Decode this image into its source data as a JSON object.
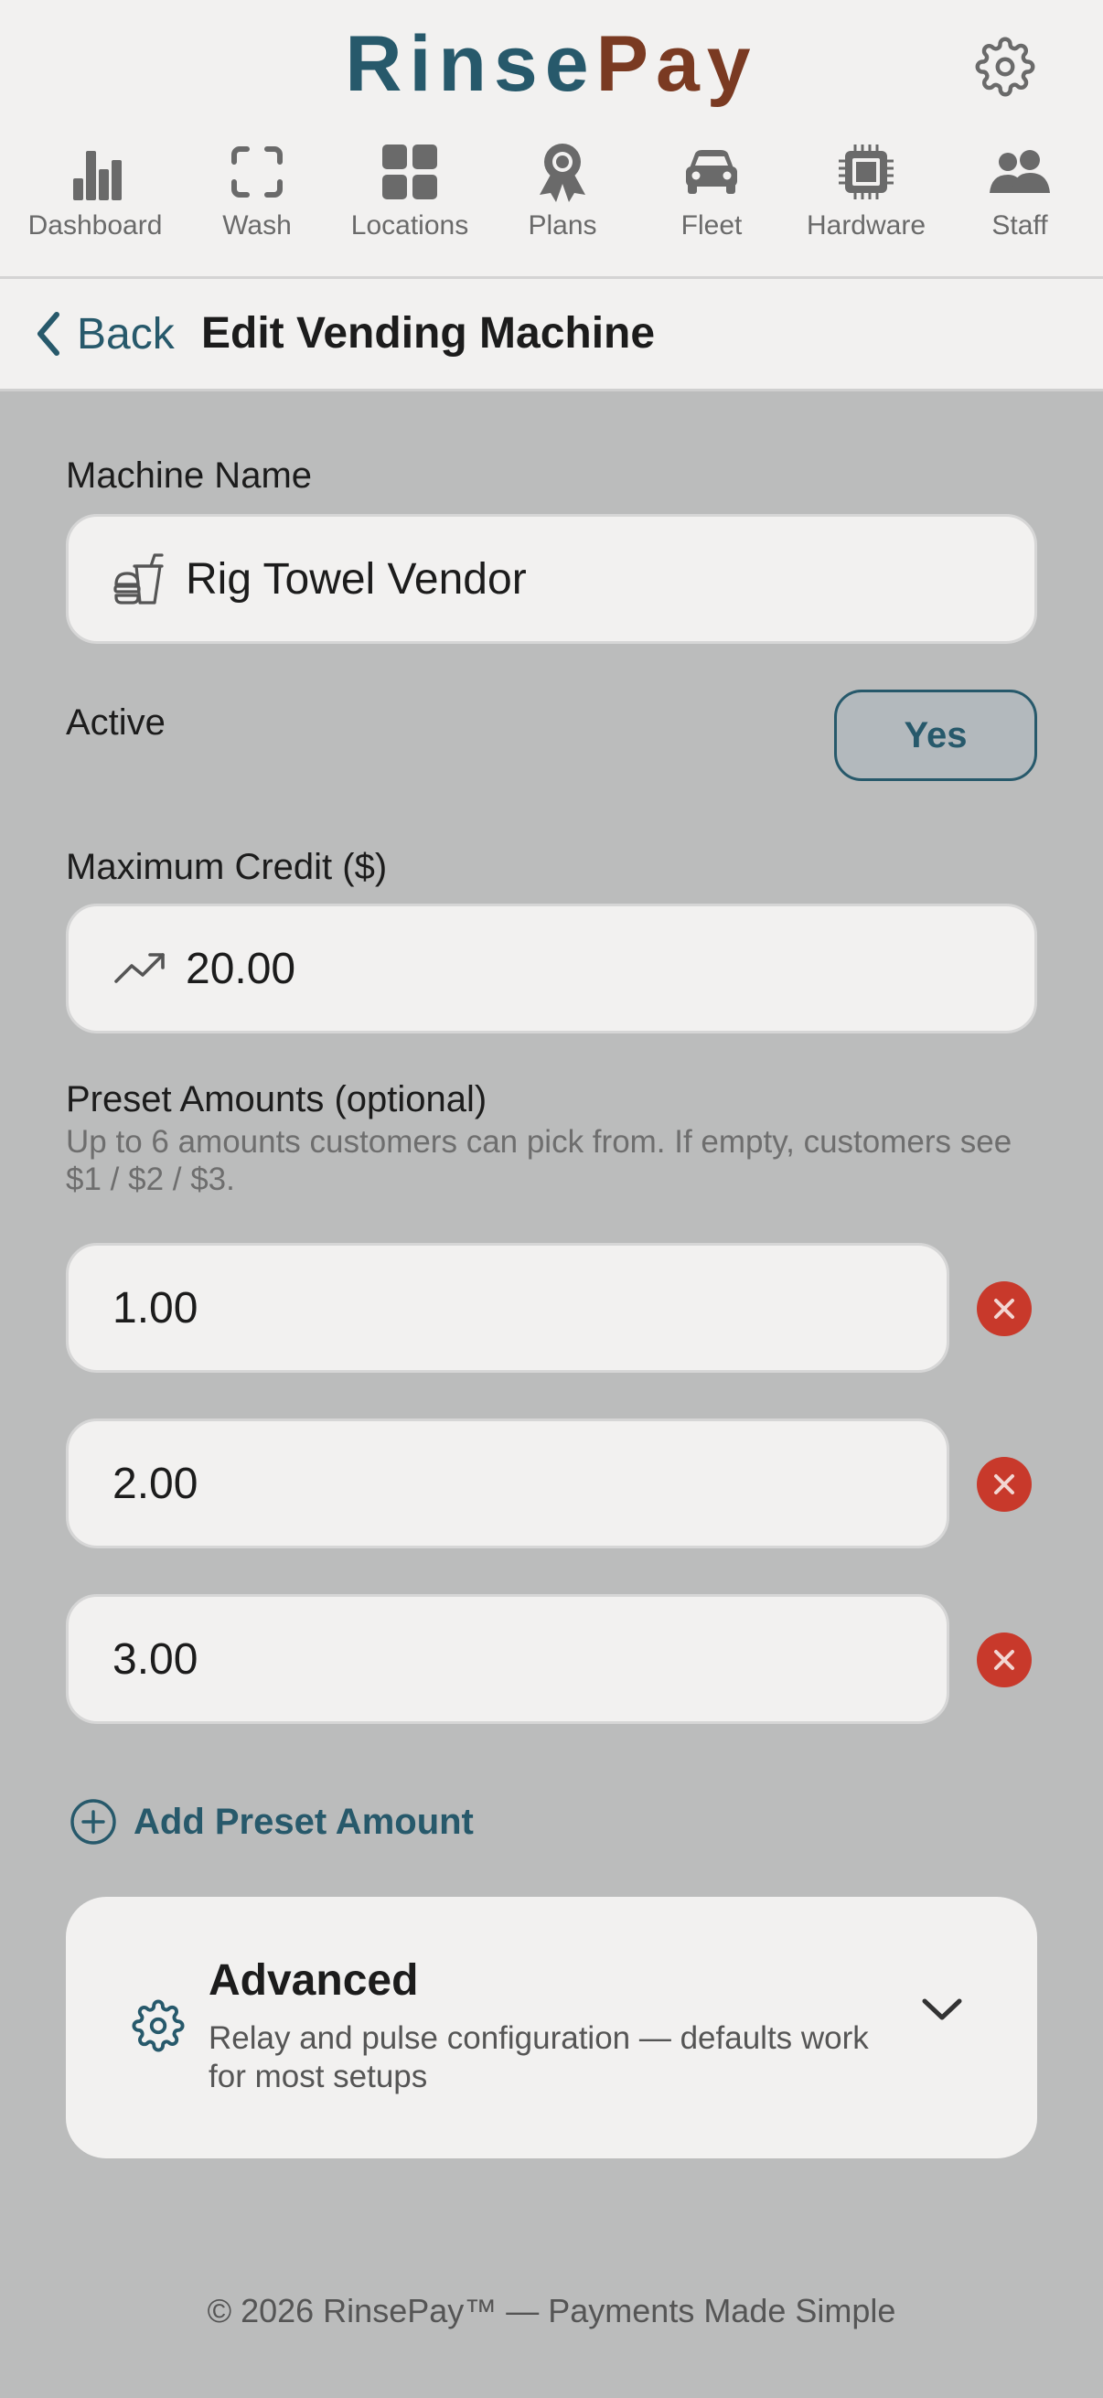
{
  "brand": {
    "part1": "Rinse",
    "part2": "Pay"
  },
  "header": {
    "settings_icon": "gear-icon"
  },
  "nav": [
    {
      "label": "Dashboard",
      "icon": "bar-chart-icon"
    },
    {
      "label": "Wash",
      "icon": "scan-frame-icon"
    },
    {
      "label": "Locations",
      "icon": "grid-icon"
    },
    {
      "label": "Plans",
      "icon": "award-ribbon-icon"
    },
    {
      "label": "Fleet",
      "icon": "car-icon"
    },
    {
      "label": "Hardware",
      "icon": "chip-icon"
    },
    {
      "label": "Staff",
      "icon": "users-icon"
    }
  ],
  "subheader": {
    "back_label": "Back",
    "title": "Edit Vending Machine"
  },
  "form": {
    "machine_name": {
      "label": "Machine Name",
      "value": "Rig Towel Vendor",
      "icon": "food-drink-icon"
    },
    "active": {
      "label": "Active",
      "value": "Yes"
    },
    "max_credit": {
      "label": "Maximum Credit ($)",
      "value": "20.00",
      "icon": "trending-up-icon"
    },
    "presets": {
      "label": "Preset Amounts (optional)",
      "help": "Up to 6 amounts customers can pick from. If empty, customers see $1 / $2 / $3.",
      "values": [
        "1.00",
        "2.00",
        "3.00"
      ],
      "add_label": "Add Preset Amount"
    },
    "advanced": {
      "title": "Advanced",
      "description": "Relay and pulse configuration — defaults work for most setups"
    }
  },
  "footer": "© 2026 RinsePay™ — Payments Made Simple",
  "colors": {
    "accent": "#27596b",
    "brand_secondary": "#7a3a22",
    "danger": "#c8392b",
    "background": "#bbbcbc",
    "surface": "#f2f1f0"
  }
}
